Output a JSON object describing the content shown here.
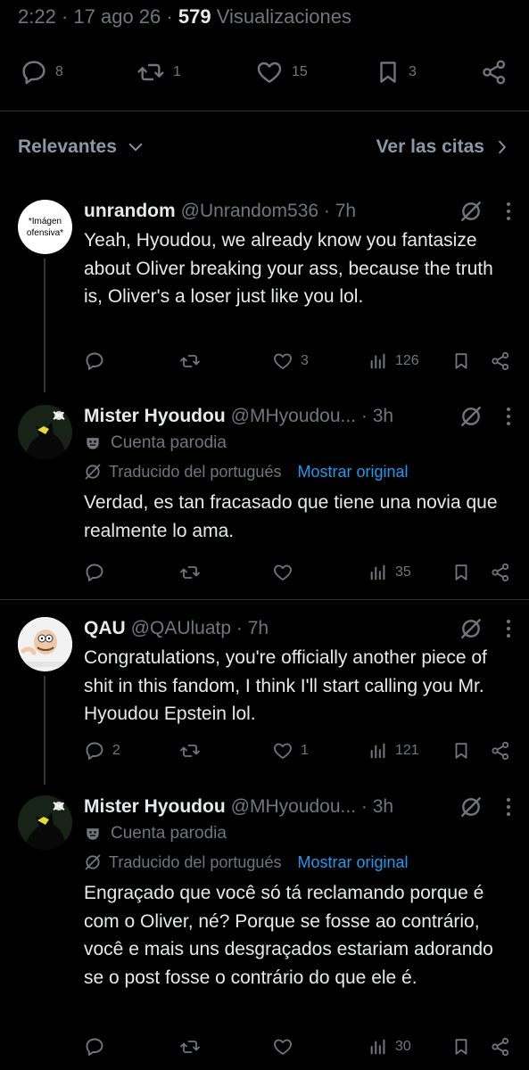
{
  "post_stats": {
    "time": "2:22",
    "date": "17 ago 26",
    "views_count": "579",
    "views_label": "Visualizaciones"
  },
  "post_actions": {
    "replies": "8",
    "reposts": "1",
    "likes": "15",
    "bookmarks": "3"
  },
  "sort": {
    "label": "Relevantes",
    "quotes_label": "Ver las citas"
  },
  "replies": [
    {
      "avatar_text_1": "*Imágen",
      "avatar_text_2": "ofensiva*",
      "name": "unrandom",
      "handle": "@Unrandom536 · 7h",
      "text": "Yeah, Hyoudou, we already know you fantasize about Oliver breaking your ass, because the truth is, Oliver's a loser just like you lol.",
      "replies": "",
      "reposts": "",
      "likes": "3",
      "views": "126"
    },
    {
      "name": "Mister Hyoudou",
      "handle": "@MHyoudou... · 3h",
      "parody_label": "Cuenta parodia",
      "translated_label": "Traducido del portugués",
      "show_original_label": "Mostrar original",
      "text": "Verdad, es tan fracasado que tiene una novia que realmente lo ama.",
      "replies": "",
      "reposts": "",
      "likes": "",
      "views": "35"
    },
    {
      "name": "QAU",
      "handle": "@QAUluatp · 7h",
      "text": "Congratulations, you're officially another piece of shit in this fandom, I think I'll start calling you Mr. Hyoudou Epstein lol.",
      "replies": "2",
      "reposts": "",
      "likes": "1",
      "views": "121"
    },
    {
      "name": "Mister Hyoudou",
      "handle": "@MHyoudou... · 3h",
      "parody_label": "Cuenta parodia",
      "translated_label": "Traducido del portugués",
      "show_original_label": "Mostrar original",
      "text": "Engraçado que você só tá reclamando porque é com o Oliver, né? Porque se fosse ao contrário, você e mais uns desgraçados estariam adorando se o post fosse o contrário do que ele é.",
      "replies": "",
      "reposts": "",
      "likes": "",
      "views": "30"
    }
  ],
  "colors": {
    "background": "#000000",
    "text_primary": "#e7e9ea",
    "text_secondary": "#71767b",
    "link_blue": "#1d9bf0",
    "divider": "#2f3336"
  }
}
